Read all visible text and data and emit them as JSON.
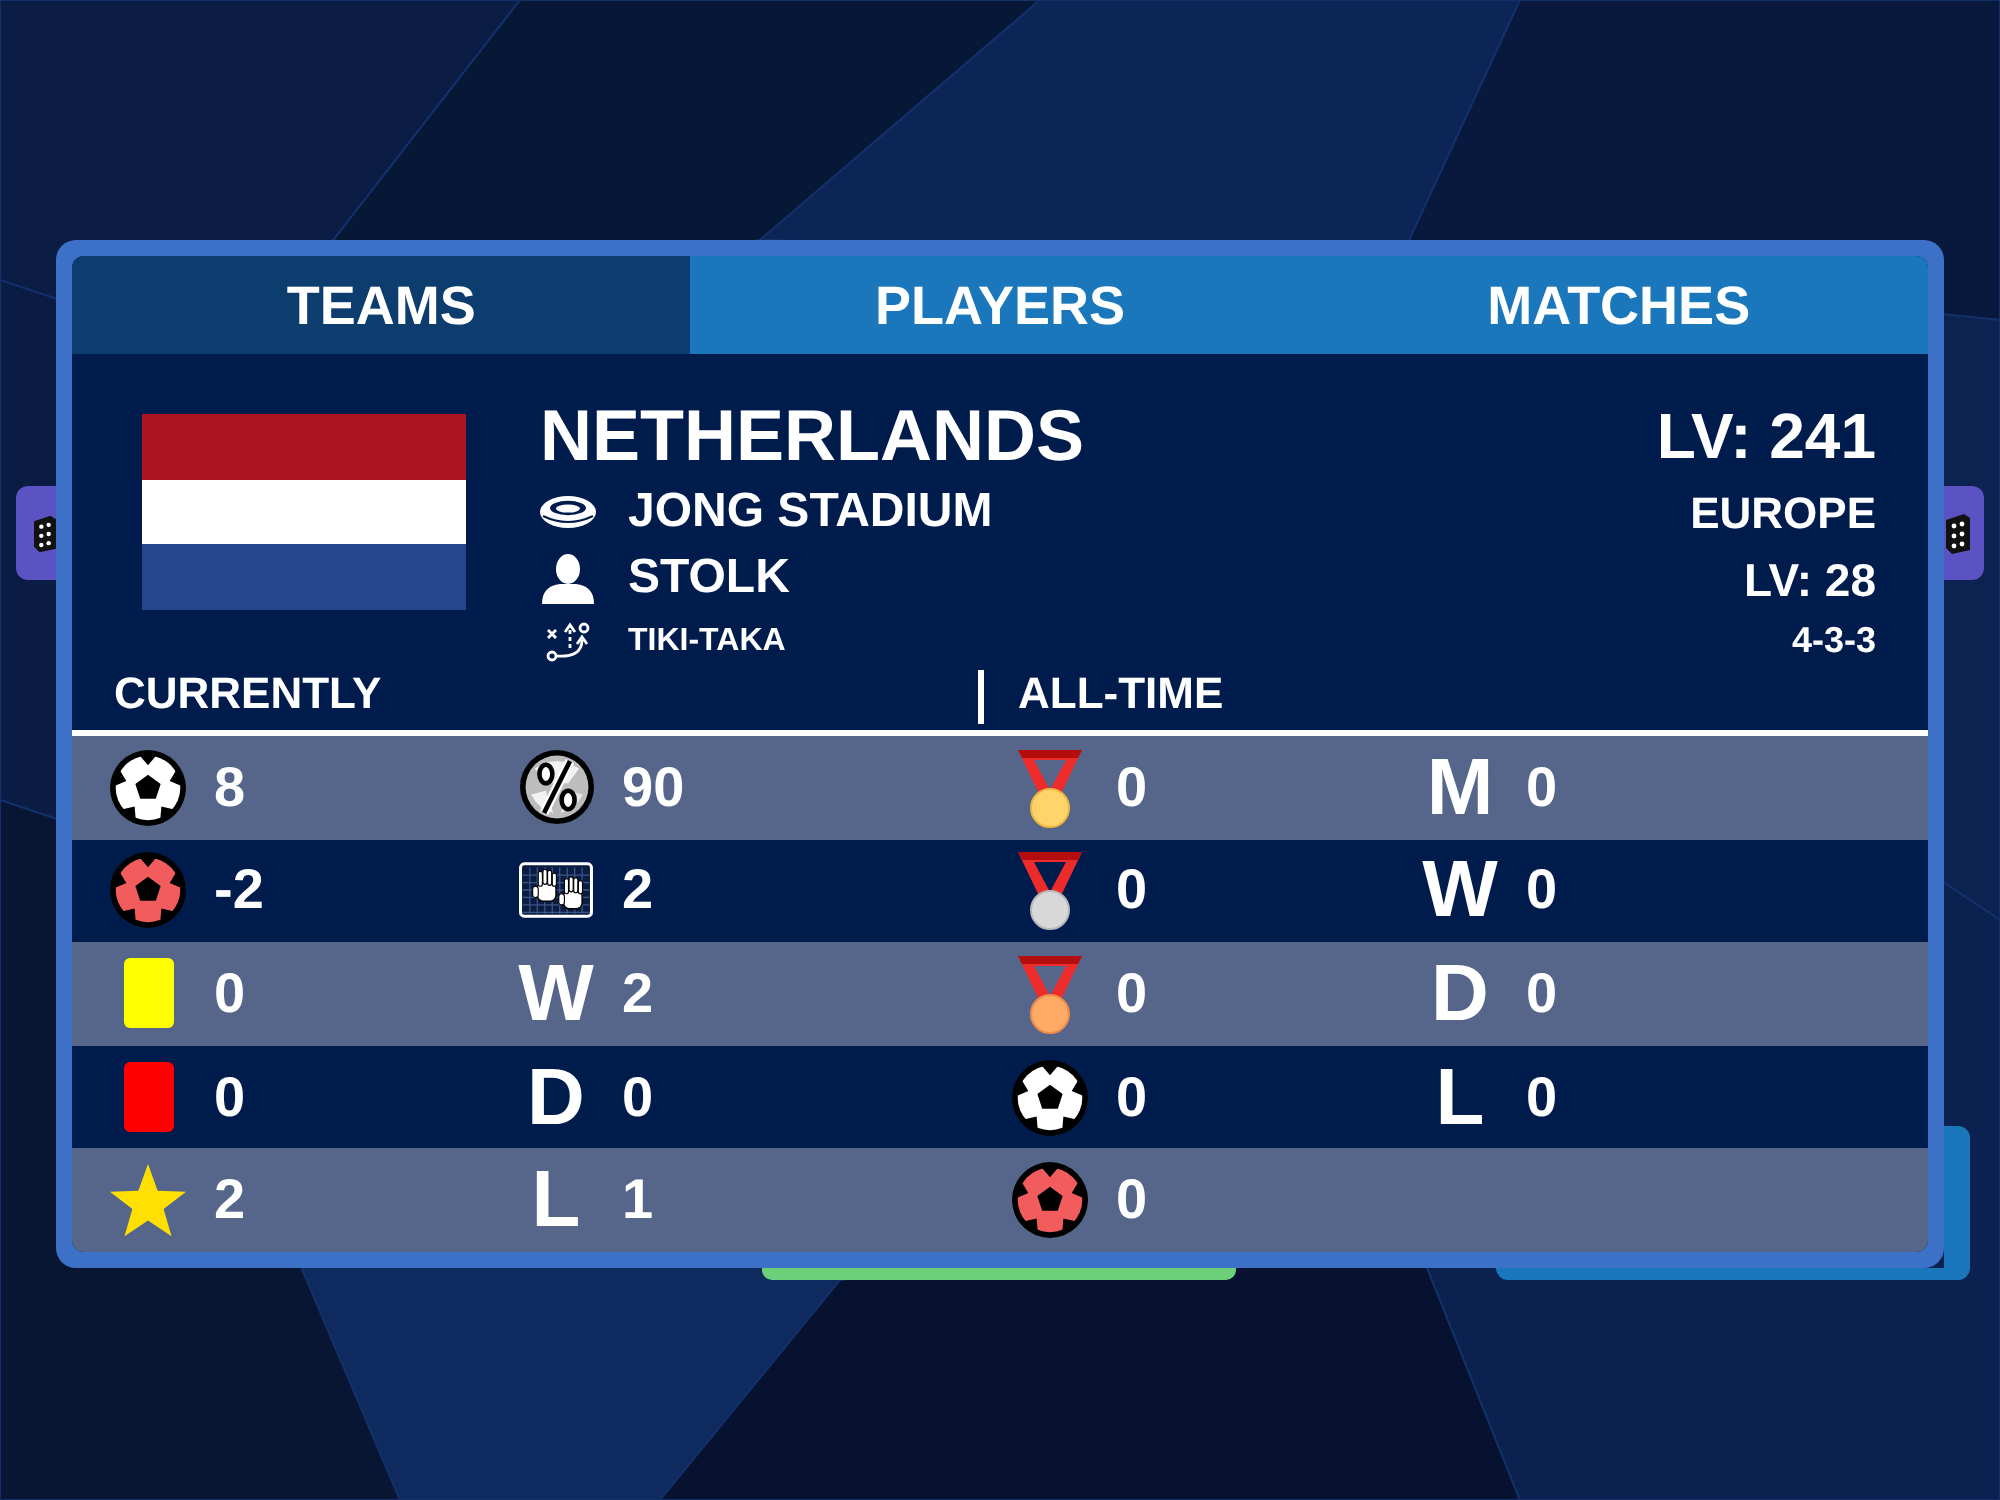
{
  "tabs": [
    {
      "label": "TEAMS",
      "selected": true
    },
    {
      "label": "PLAYERS",
      "selected": false
    },
    {
      "label": "MATCHES",
      "selected": false
    }
  ],
  "team": {
    "name": "NETHERLANDS",
    "details": [
      {
        "kind": "stadium",
        "text": "JONG STADIUM"
      },
      {
        "kind": "manager",
        "text": "STOLK"
      },
      {
        "kind": "tactic",
        "text": "TIKI-TAKA"
      }
    ],
    "level": "LV: 241",
    "region": "EUROPE",
    "region_level": "LV: 28",
    "formation": "4-3-3"
  },
  "sections": [
    "CURRENTLY",
    "ALL-TIME"
  ],
  "stats": [
    [
      {
        "kind": "scored",
        "value": "8"
      },
      {
        "kind": "possession",
        "value": "90"
      },
      {
        "kind": "gold",
        "value": "0"
      },
      {
        "kind": "letter",
        "label": "M",
        "value": "0"
      }
    ],
    [
      {
        "kind": "conceded",
        "value": "-2"
      },
      {
        "kind": "saves",
        "value": "2"
      },
      {
        "kind": "silver",
        "value": "0"
      },
      {
        "kind": "letter",
        "label": "W",
        "value": "0"
      }
    ],
    [
      {
        "kind": "yellowcard",
        "value": "0"
      },
      {
        "kind": "letter",
        "label": "W",
        "value": "2"
      },
      {
        "kind": "bronze",
        "value": "0"
      },
      {
        "kind": "letter",
        "label": "D",
        "value": "0"
      }
    ],
    [
      {
        "kind": "redcard",
        "value": "0"
      },
      {
        "kind": "letter",
        "label": "D",
        "value": "0"
      },
      {
        "kind": "scored",
        "value": "0"
      },
      {
        "kind": "letter",
        "label": "L",
        "value": "0"
      }
    ],
    [
      {
        "kind": "star",
        "value": "2"
      },
      {
        "kind": "letter",
        "label": "L",
        "value": "1"
      },
      {
        "kind": "conceded",
        "value": "0"
      }
    ]
  ]
}
